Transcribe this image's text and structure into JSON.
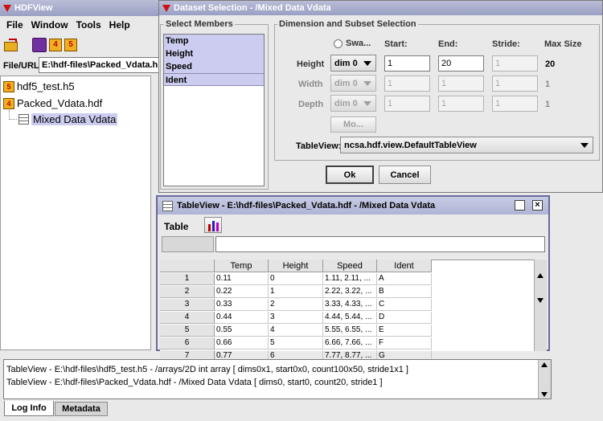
{
  "main_window": {
    "title": "HDFView",
    "menu": [
      "File",
      "Window",
      "Tools",
      "Help"
    ],
    "file_url_label": "File/URL",
    "file_url_value": "E:\\hdf-files\\Packed_Vdata.h"
  },
  "tree": {
    "nodes": [
      {
        "label": "hdf5_test.h5",
        "icon": "h5-file-icon"
      },
      {
        "label": "Packed_Vdata.hdf",
        "icon": "h4-file-icon"
      },
      {
        "label": "Mixed Data Vdata",
        "icon": "table-icon"
      }
    ]
  },
  "dialog": {
    "title": "Dataset Selection - /Mixed Data Vdata",
    "select_members_label": "Select Members",
    "members": [
      "Temp",
      "Height",
      "Speed",
      "Ident"
    ],
    "dimension_group_label": "Dimension and Subset Selection",
    "swap_label": "Swa...",
    "col_start": "Start:",
    "col_end": "End:",
    "col_stride": "Stride:",
    "col_max": "Max Size",
    "rows": [
      {
        "label": "Height",
        "dim": "dim 0",
        "start": "1",
        "end": "20",
        "stride": "1",
        "max": "20"
      },
      {
        "label": "Width",
        "dim": "dim 0",
        "start": "1",
        "end": "1",
        "stride": "1",
        "max": "1"
      },
      {
        "label": "Depth",
        "dim": "dim 0",
        "start": "1",
        "end": "1",
        "stride": "1",
        "max": "1"
      }
    ],
    "more_button": "Mo...",
    "tableview_label": "TableView:",
    "tableview_value": "ncsa.hdf.view.DefaultTableView",
    "ok": "Ok",
    "cancel": "Cancel"
  },
  "table_window": {
    "title": "TableView - E:\\hdf-files\\Packed_Vdata.hdf - /Mixed Data Vdata",
    "menu_table": "Table",
    "columns": [
      "Temp",
      "Height",
      "Speed",
      "Ident"
    ],
    "rows": [
      [
        "1",
        "0.11",
        "0",
        "1.11, 2.11, ...",
        "A"
      ],
      [
        "2",
        "0.22",
        "1",
        "2.22, 3.22, ...",
        "B"
      ],
      [
        "3",
        "0.33",
        "2",
        "3.33, 4.33, ...",
        "C"
      ],
      [
        "4",
        "0.44",
        "3",
        "4.44, 5.44, ...",
        "D"
      ],
      [
        "5",
        "0.55",
        "4",
        "5.55, 6.55, ...",
        "E"
      ],
      [
        "6",
        "0.66",
        "5",
        "6.66, 7.66, ...",
        "F"
      ],
      [
        "7",
        "0.77",
        "6",
        "7.77, 8.77, ...",
        "G"
      ]
    ]
  },
  "log": {
    "lines": [
      "TableView - E:\\hdf-files\\hdf5_test.h5 - /arrays/2D int array [ dims0x1, start0x0, count100x50, stride1x1 ]",
      "TableView - E:\\hdf-files\\Packed_Vdata.hdf - /Mixed Data Vdata [ dims0, start0, count20, stride1 ]"
    ],
    "tabs": [
      "Log Info",
      "Metadata"
    ]
  },
  "colors": {
    "selection": "#ccccf0",
    "title_gradient_top": "#b9bdd6",
    "close_red": "#d01010"
  }
}
